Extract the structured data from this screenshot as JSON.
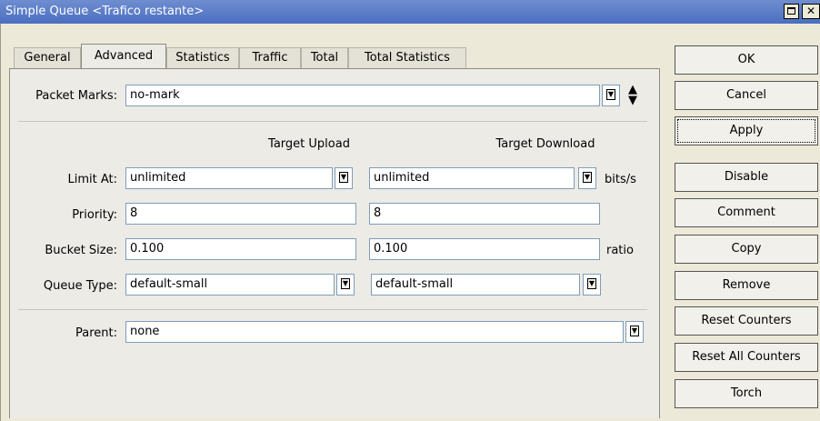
{
  "window": {
    "title": "Simple Queue <Trafico restante>"
  },
  "tabs": [
    {
      "label": "General"
    },
    {
      "label": "Advanced"
    },
    {
      "label": "Statistics"
    },
    {
      "label": "Traffic"
    },
    {
      "label": "Total"
    },
    {
      "label": "Total Statistics"
    }
  ],
  "form": {
    "packet_marks": {
      "label": "Packet Marks:",
      "value": "no-mark"
    },
    "target_upload_header": "Target Upload",
    "target_download_header": "Target Download",
    "limit_at": {
      "label": "Limit At:",
      "upload": "unlimited",
      "download": "unlimited",
      "unit": "bits/s"
    },
    "priority": {
      "label": "Priority:",
      "upload": "8",
      "download": "8"
    },
    "bucket_size": {
      "label": "Bucket Size:",
      "upload": "0.100",
      "download": "0.100",
      "unit": "ratio"
    },
    "queue_type": {
      "label": "Queue Type:",
      "upload": "default-small",
      "download": "default-small"
    },
    "parent": {
      "label": "Parent:",
      "value": "none"
    }
  },
  "buttons": [
    {
      "label": "OK"
    },
    {
      "label": "Cancel"
    },
    {
      "label": "Apply"
    },
    {
      "label": "Disable"
    },
    {
      "label": "Comment"
    },
    {
      "label": "Copy"
    },
    {
      "label": "Remove"
    },
    {
      "label": "Reset Counters"
    },
    {
      "label": "Reset All Counters"
    },
    {
      "label": "Torch"
    }
  ],
  "icons": {
    "dropdown": "dropdown-arrow-icon",
    "updown": "up-down-arrow-icon",
    "maximize": "maximize-icon",
    "close": "close-icon"
  }
}
